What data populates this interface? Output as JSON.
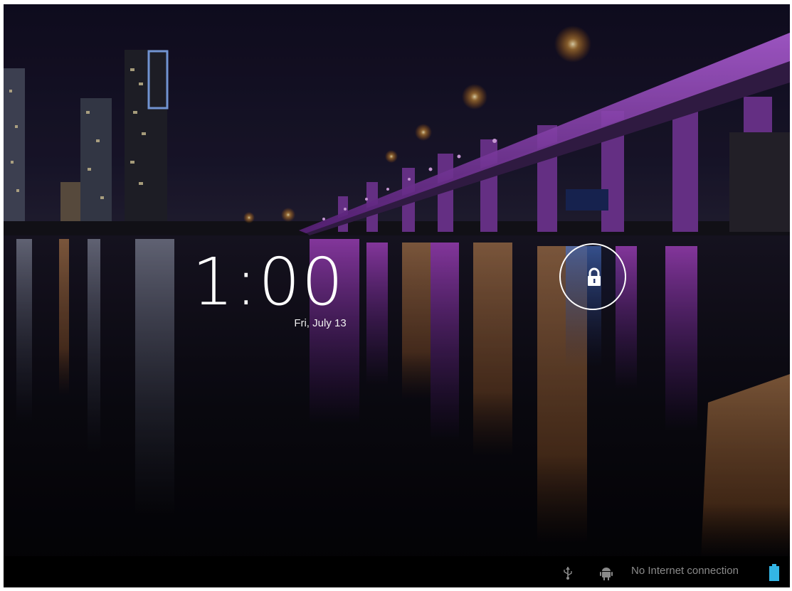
{
  "lockscreen": {
    "time": "1:00",
    "date": "Fri, July 13"
  },
  "status_bar": {
    "connection_text": "No Internet connection",
    "icons": [
      "usb-icon",
      "android-debug-icon",
      "battery-icon"
    ]
  },
  "colors": {
    "bridge_light": "#b040d8",
    "battery": "#33b5e5",
    "status_text": "#8a8a8a"
  }
}
